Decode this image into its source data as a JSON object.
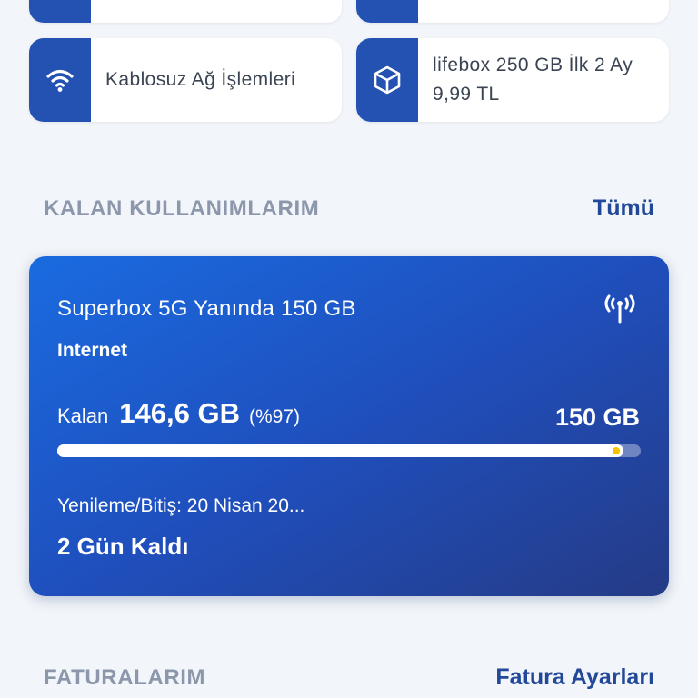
{
  "quick_actions": [
    {
      "label": "",
      "icon": "blank-icon"
    },
    {
      "label": "",
      "icon": "blank-icon"
    },
    {
      "label": "Kablosuz Ağ İşlemleri",
      "icon": "wifi-icon"
    },
    {
      "label": "lifebox 250 GB İlk 2 Ay 9,99 TL",
      "icon": "box-icon"
    }
  ],
  "usage_section": {
    "title": "KALAN KULLANIMLARIM",
    "link": "Tümü"
  },
  "usage_card": {
    "package_name": "Superbox 5G Yanında 150 GB",
    "type_label": "Internet",
    "remaining_prefix": "Kalan",
    "remaining_value": "146,6 GB",
    "remaining_percent_text": "(%97)",
    "total": "150 GB",
    "progress_fraction": 0.97,
    "renewal": "Yenileme/Bitiş: 20 Nisan 20...",
    "days_left": "2 Gün Kaldı",
    "icon": "antenna-signal-icon"
  },
  "bills_section": {
    "title": "FATURALARIM",
    "link": "Fatura Ayarları"
  },
  "colors": {
    "brand_blue": "#2352b3",
    "link_blue": "#22489a",
    "progress_dot": "#f5c400"
  }
}
